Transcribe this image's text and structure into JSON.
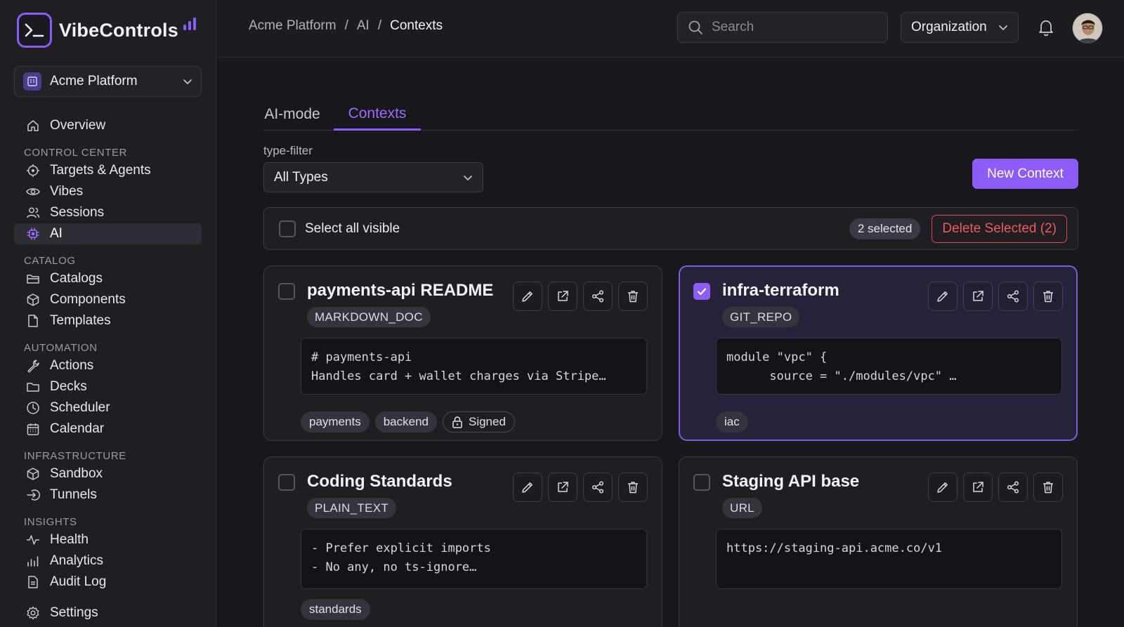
{
  "brand": {
    "name": "VibeControls"
  },
  "project": {
    "name": "Acme Platform"
  },
  "sidebar": {
    "top_items": [
      {
        "label": "Overview",
        "icon": "home-icon"
      }
    ],
    "sections": [
      {
        "title": "CONTROL CENTER",
        "items": [
          {
            "label": "Targets & Agents",
            "icon": "target-icon"
          },
          {
            "label": "Vibes",
            "icon": "eye-icon"
          },
          {
            "label": "Sessions",
            "icon": "users-icon"
          },
          {
            "label": "AI",
            "icon": "cpu-icon",
            "active": true
          }
        ]
      },
      {
        "title": "CATALOG",
        "items": [
          {
            "label": "Catalogs",
            "icon": "stack-icon"
          },
          {
            "label": "Components",
            "icon": "box-icon"
          },
          {
            "label": "Templates",
            "icon": "file-icon"
          }
        ]
      },
      {
        "title": "AUTOMATION",
        "items": [
          {
            "label": "Actions",
            "icon": "wrench-icon"
          },
          {
            "label": "Decks",
            "icon": "folder-icon"
          },
          {
            "label": "Scheduler",
            "icon": "clock-icon"
          },
          {
            "label": "Calendar",
            "icon": "calendar-icon"
          }
        ]
      },
      {
        "title": "INFRASTRUCTURE",
        "items": [
          {
            "label": "Sandbox",
            "icon": "box-icon"
          },
          {
            "label": "Tunnels",
            "icon": "tunnel-icon"
          }
        ]
      },
      {
        "title": "INSIGHTS",
        "items": [
          {
            "label": "Health",
            "icon": "pulse-icon"
          },
          {
            "label": "Analytics",
            "icon": "bar-chart-icon"
          },
          {
            "label": "Audit Log",
            "icon": "document-icon"
          }
        ]
      }
    ],
    "bottom_items": [
      {
        "label": "Settings",
        "icon": "gear-icon"
      }
    ]
  },
  "header": {
    "breadcrumb": [
      "Acme Platform",
      "AI",
      "Contexts"
    ],
    "breadcrumb_sep": "/",
    "search_placeholder": "Search",
    "org_label": "Organization"
  },
  "tabs": [
    {
      "label": "AI-mode",
      "active": false
    },
    {
      "label": "Contexts",
      "active": true
    }
  ],
  "filter": {
    "label": "type-filter",
    "value": "All Types"
  },
  "new_context_label": "New Context",
  "bulk": {
    "select_all_label": "Select all visible",
    "selected_badge": "2 selected",
    "delete_label": "Delete Selected (2)"
  },
  "cards": [
    {
      "title": "payments-api README",
      "type": "MARKDOWN_DOC",
      "checked": false,
      "content": "# payments-api\nHandles card + wallet charges via Stripe…",
      "tags": [
        "payments",
        "backend"
      ],
      "signed_label": "Signed"
    },
    {
      "title": "infra-terraform",
      "type": "GIT_REPO",
      "checked": true,
      "content": "module \"vpc\" {\n      source = \"./modules/vpc\" …",
      "tags": [
        "iac"
      ]
    },
    {
      "title": "Coding Standards",
      "type": "PLAIN_TEXT",
      "checked": false,
      "content": "- Prefer explicit imports\n- No any, no ts-ignore…",
      "tags": [
        "standards"
      ]
    },
    {
      "title": "Staging API base",
      "type": "URL",
      "checked": false,
      "content": "https://staging-api.acme.co/v1",
      "tags": []
    }
  ],
  "colors": {
    "accent": "#8b5cf6",
    "danger": "#f0595d",
    "background": "#18181c",
    "sidebar": "#1e1e23"
  }
}
